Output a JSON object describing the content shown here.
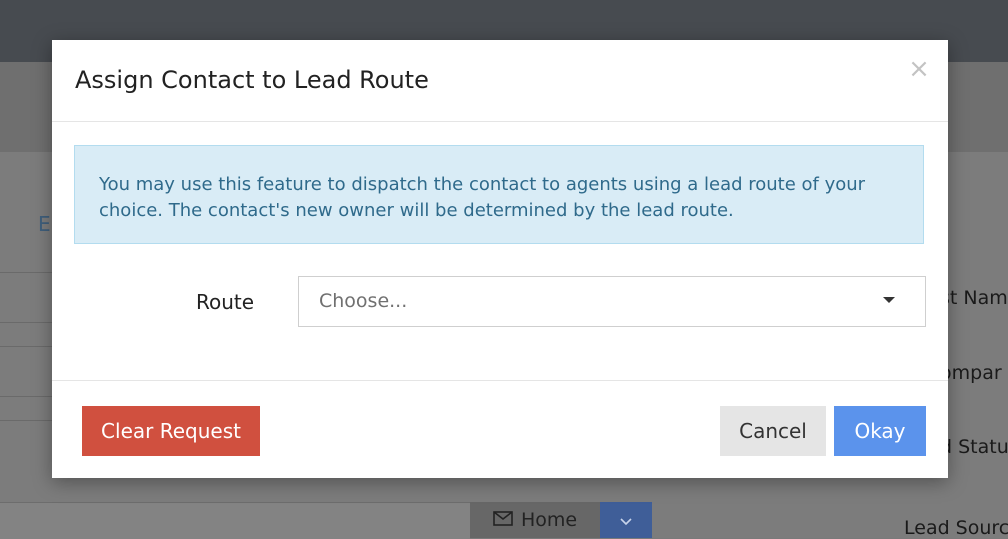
{
  "background": {
    "tab_label": "E",
    "right_labels": [
      "st Nam",
      "ompar",
      "d Statu"
    ],
    "home_button_label": "Home",
    "lead_source_label": "Lead Sourc"
  },
  "modal": {
    "title": "Assign Contact to Lead Route",
    "close_symbol": "×",
    "info_text": "You may use this feature to dispatch the contact to agents using a lead route of your choice. The contact's new owner will be determined by the lead route.",
    "route_label": "Route",
    "route_select_value": "Choose...",
    "clear_button_label": "Clear Request",
    "cancel_button_label": "Cancel",
    "okay_button_label": "Okay"
  },
  "colors": {
    "clear_button": "#d0503f",
    "okay_button": "#5b93ec",
    "cancel_button": "#e5e5e5",
    "info_background": "#d9ecf6",
    "info_text": "#2f6a8b"
  },
  "icons": {
    "close": "close-icon",
    "dropdown": "caret-down-icon",
    "home": "envelope-icon",
    "home_dropdown": "chevron-down-icon"
  }
}
